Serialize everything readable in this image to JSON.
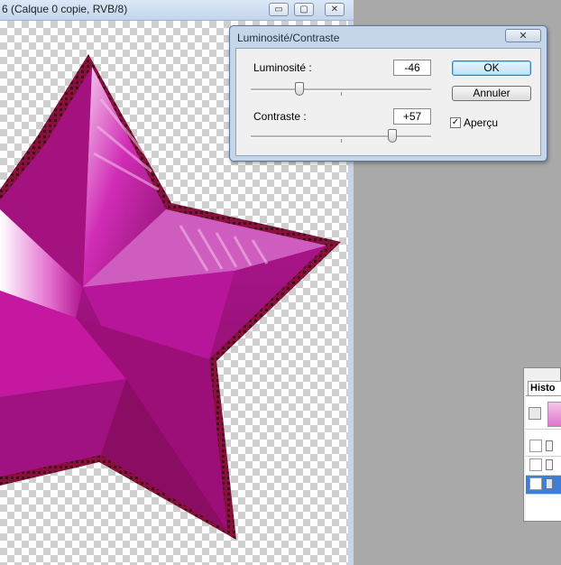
{
  "document": {
    "title": "6 (Calque 0 copie, RVB/8)",
    "window_buttons": {
      "minimize": "▭",
      "maximize": "▢",
      "close": "✕"
    }
  },
  "dialog": {
    "title": "Luminosité/Contraste",
    "close_label": "✕",
    "brightness": {
      "label": "Luminosité :",
      "value": "-46"
    },
    "contrast": {
      "label": "Contraste :",
      "value": "+57"
    },
    "ok_label": "OK",
    "cancel_label": "Annuler",
    "preview_label": "Aperçu",
    "preview_checked": "✓"
  },
  "history_panel": {
    "tab_label": "Histo"
  },
  "colors": {
    "star_magenta": "#c0169f",
    "star_edge": "#8b0f3c",
    "accent_button": "#bfe3f8"
  }
}
